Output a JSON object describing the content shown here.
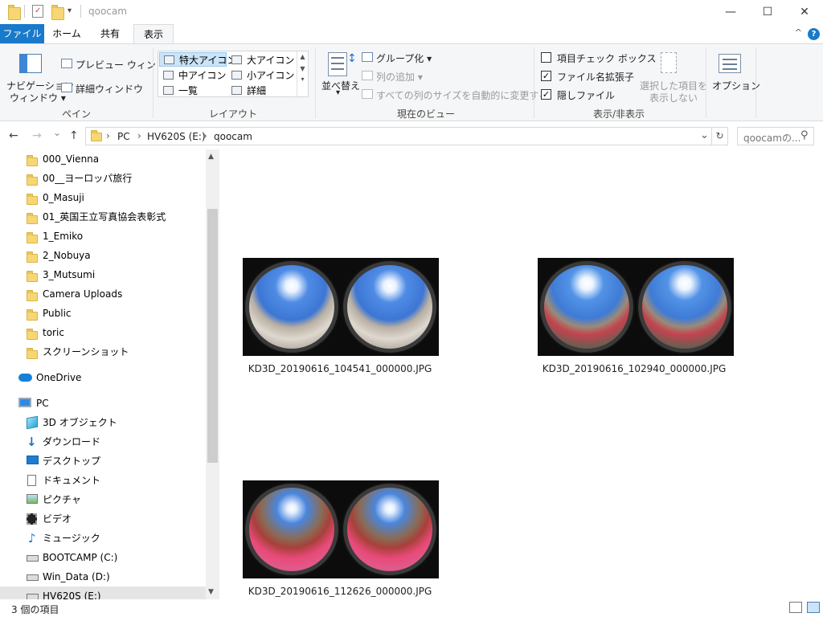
{
  "window": {
    "title": "qoocam",
    "minimize": "—",
    "maximize": "☐",
    "close": "✕"
  },
  "ribbon_tabs": {
    "file": "ファイル",
    "home": "ホーム",
    "share": "共有",
    "view": "表示",
    "help": "?",
    "collapse": "^"
  },
  "ribbon": {
    "pane": {
      "navigation_pane": "ナビゲーション\nウィンドウ",
      "navigation_pane_line1": "ナビゲーション",
      "navigation_pane_line2": "ウィンドウ ▾",
      "preview_pane": "プレビュー ウィンドウ",
      "details_pane": "詳細ウィンドウ",
      "group_label": "ペイン"
    },
    "layout": {
      "extra_large_icons": "特大アイコン",
      "large_icons": "大アイコン",
      "medium_icons": "中アイコン",
      "small_icons": "小アイコン",
      "list": "一覧",
      "details": "詳細",
      "group_label": "レイアウト"
    },
    "current_view": {
      "sort_by_line1": "並べ替え",
      "sort_by_line2": "▾",
      "group_by": "グループ化 ▾",
      "add_columns": "列の追加 ▾",
      "size_all_columns": "すべての列のサイズを自動的に変更する",
      "group_label": "現在のビュー"
    },
    "show_hide": {
      "item_check_boxes": "項目チェック ボックス",
      "item_check_boxes_checked": false,
      "file_name_extensions": "ファイル名拡張子",
      "file_name_extensions_checked": true,
      "hidden_items": "隠しファイル",
      "hidden_items_checked": true,
      "hide_selected_line1": "選択した項目を",
      "hide_selected_line2": "表示しない",
      "group_label": "表示/非表示"
    },
    "options": {
      "label": "オプション"
    }
  },
  "address_bar": {
    "back": "←",
    "forward": "→",
    "recent": "⌄",
    "up": "↑",
    "breadcrumb": [
      "PC",
      "HV620S (E:)",
      "qoocam"
    ],
    "separator": "›",
    "dropdown": "⌄",
    "refresh": "↻",
    "search_placeholder": "qoocamの...",
    "search_icon": "⚲"
  },
  "nav_pane": {
    "items": [
      {
        "label": "000_Vienna",
        "icon": "folder-icon"
      },
      {
        "label": "00__ヨーロッパ旅行",
        "icon": "folder-icon"
      },
      {
        "label": "0_Masuji",
        "icon": "folder-icon"
      },
      {
        "label": "01_英国王立写真協会表彰式",
        "icon": "folder-icon"
      },
      {
        "label": "1_Emiko",
        "icon": "folder-icon"
      },
      {
        "label": "2_Nobuya",
        "icon": "folder-icon"
      },
      {
        "label": "3_Mutsumi",
        "icon": "folder-icon"
      },
      {
        "label": "Camera Uploads",
        "icon": "folder-icon"
      },
      {
        "label": "Public",
        "icon": "folder-icon"
      },
      {
        "label": "toric",
        "icon": "folder-icon"
      },
      {
        "label": "スクリーンショット",
        "icon": "folder-icon"
      }
    ],
    "onedrive": "OneDrive",
    "pc": "PC",
    "pc_items": [
      {
        "label": "3D オブジェクト",
        "icon": "3d-objects-icon"
      },
      {
        "label": "ダウンロード",
        "icon": "downloads-icon"
      },
      {
        "label": "デスクトップ",
        "icon": "desktop-icon"
      },
      {
        "label": "ドキュメント",
        "icon": "documents-icon"
      },
      {
        "label": "ピクチャ",
        "icon": "pictures-icon"
      },
      {
        "label": "ビデオ",
        "icon": "videos-icon"
      },
      {
        "label": "ミュージック",
        "icon": "music-icon"
      },
      {
        "label": "BOOTCAMP (C:)",
        "icon": "drive-icon"
      },
      {
        "label": "Win_Data (D:)",
        "icon": "drive-icon"
      },
      {
        "label": "HV620S (E:)",
        "icon": "drive-icon"
      }
    ],
    "scroll_up": "▲",
    "scroll_down": "▼"
  },
  "files": [
    {
      "name": "KD3D_20190616_104541_000000.JPG"
    },
    {
      "name": "KD3D_20190616_102940_000000.JPG"
    },
    {
      "name": "KD3D_20190616_112626_000000.JPG"
    }
  ],
  "status_bar": {
    "item_count": "3 個の項目"
  }
}
